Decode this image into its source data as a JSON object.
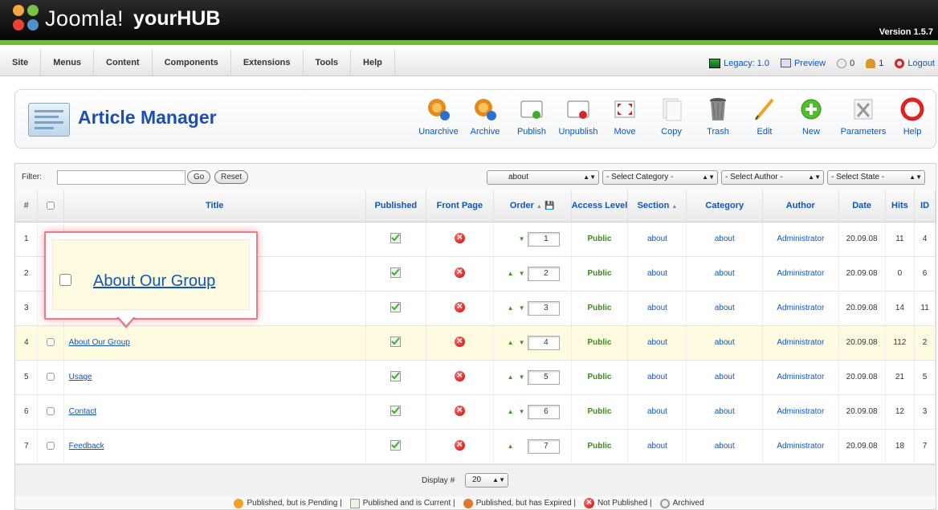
{
  "header": {
    "logo_text": "Joomla!",
    "site_name": "yourHUB",
    "version": "Version 1.5.7"
  },
  "menubar": {
    "items": [
      {
        "label": "Site"
      },
      {
        "label": "Menus"
      },
      {
        "label": "Content"
      },
      {
        "label": "Components"
      },
      {
        "label": "Extensions"
      },
      {
        "label": "Tools"
      },
      {
        "label": "Help"
      }
    ],
    "status": {
      "legacy": "Legacy: 1.0",
      "preview": "Preview",
      "messages": "0",
      "users": "1",
      "logout": "Logout"
    }
  },
  "toolbar": {
    "title": "Article Manager",
    "buttons": [
      {
        "label": "Unarchive",
        "icon": "unarchive-icon"
      },
      {
        "label": "Archive",
        "icon": "archive-icon"
      },
      {
        "label": "Publish",
        "icon": "publish-icon"
      },
      {
        "label": "Unpublish",
        "icon": "unpublish-icon"
      },
      {
        "label": "Move",
        "icon": "move-icon"
      },
      {
        "label": "Copy",
        "icon": "copy-icon"
      },
      {
        "label": "Trash",
        "icon": "trash-icon"
      },
      {
        "label": "Edit",
        "icon": "edit-icon"
      },
      {
        "label": "New",
        "icon": "new-icon"
      },
      {
        "label": "Parameters",
        "icon": "parameters-icon"
      },
      {
        "label": "Help",
        "icon": "help-icon"
      }
    ]
  },
  "filter": {
    "label": "Filter:",
    "value": "",
    "go_label": "Go",
    "reset_label": "Reset",
    "section_select": "about",
    "category_select": "- Select Category -",
    "author_select": "- Select Author -",
    "state_select": "- Select State -"
  },
  "table": {
    "headers": {
      "num": "#",
      "title": "Title",
      "published": "Published",
      "front_page": "Front Page",
      "order": "Order",
      "access_level": "Access Level",
      "section": "Section",
      "category": "Category",
      "author": "Author",
      "date": "Date",
      "hits": "Hits",
      "id": "ID"
    },
    "rows": [
      {
        "num": "1",
        "title": "",
        "order": "1",
        "access": "Public",
        "section": "about",
        "category": "about",
        "author": "Administrator",
        "date": "20.09.08",
        "hits": "11",
        "id": "4"
      },
      {
        "num": "2",
        "title": "",
        "order": "2",
        "access": "Public",
        "section": "about",
        "category": "about",
        "author": "Administrator",
        "date": "20.09.08",
        "hits": "0",
        "id": "6"
      },
      {
        "num": "3",
        "title": "",
        "order": "3",
        "access": "Public",
        "section": "about",
        "category": "about",
        "author": "Administrator",
        "date": "20.09.08",
        "hits": "14",
        "id": "11"
      },
      {
        "num": "4",
        "title": "About Our Group",
        "order": "4",
        "access": "Public",
        "section": "about",
        "category": "about",
        "author": "Administrator",
        "date": "20.09.08",
        "hits": "112",
        "id": "2"
      },
      {
        "num": "5",
        "title": "Usage",
        "order": "5",
        "access": "Public",
        "section": "about",
        "category": "about",
        "author": "Administrator",
        "date": "20.09.08",
        "hits": "21",
        "id": "5"
      },
      {
        "num": "6",
        "title": "Contact",
        "order": "6",
        "access": "Public",
        "section": "about",
        "category": "about",
        "author": "Administrator",
        "date": "20.09.08",
        "hits": "12",
        "id": "3"
      },
      {
        "num": "7",
        "title": "Feedback",
        "order": "7",
        "access": "Public",
        "section": "about",
        "category": "about",
        "author": "Administrator",
        "date": "20.09.08",
        "hits": "18",
        "id": "7"
      }
    ]
  },
  "footer": {
    "display_label": "Display #",
    "display_value": "20"
  },
  "legend": {
    "pending": "Published, but is Pending |",
    "current": "Published and is Current |",
    "expired": "Published, but has Expired |",
    "not_published": "Not Published |",
    "archived": "Archived"
  },
  "callout": {
    "title": "About Our Group"
  }
}
